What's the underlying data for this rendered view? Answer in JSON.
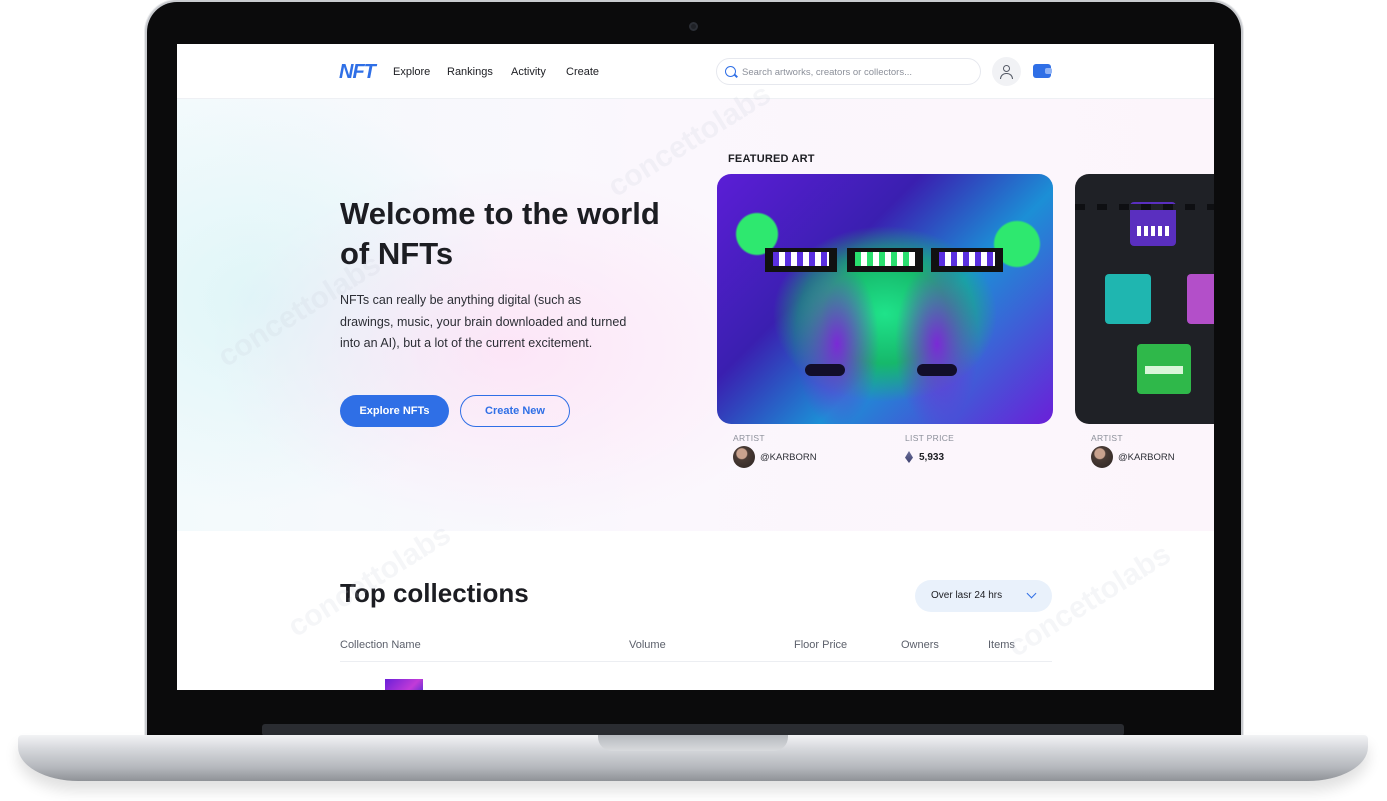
{
  "nav": {
    "logo": "NFT",
    "links": [
      "Explore",
      "Rankings",
      "Activity",
      "Create"
    ],
    "search_placeholder": "Search artworks, creators or collectors..."
  },
  "hero": {
    "title": "Welcome to the world of NFTs",
    "description": "NFTs can really be anything digital (such as drawings, music, your brain downloaded and turned into an AI), but a lot of the current excitement.",
    "primary_button": "Explore NFTs",
    "secondary_button": "Create New"
  },
  "featured": {
    "label": "FEATURED ART",
    "cards": [
      {
        "artist_label": "ARTIST",
        "artist": "@KARBORN",
        "price_label": "LIST PRICE",
        "price": "5,933"
      },
      {
        "artist_label": "ARTIST",
        "artist": "@KARBORN"
      }
    ]
  },
  "collections": {
    "title": "Top collections",
    "period": "Over lasr 24 hrs",
    "columns": [
      "Collection Name",
      "Volume",
      "Floor Price",
      "Owners",
      "Items"
    ]
  },
  "colors": {
    "accent": "#2f6fe6",
    "text": "#1c1d22",
    "pill_bg": "#e9f1fb"
  },
  "icons": [
    "search-icon",
    "user-icon",
    "wallet-icon",
    "ethereum-icon",
    "chevron-down-icon"
  ],
  "watermark": "concettolabs"
}
